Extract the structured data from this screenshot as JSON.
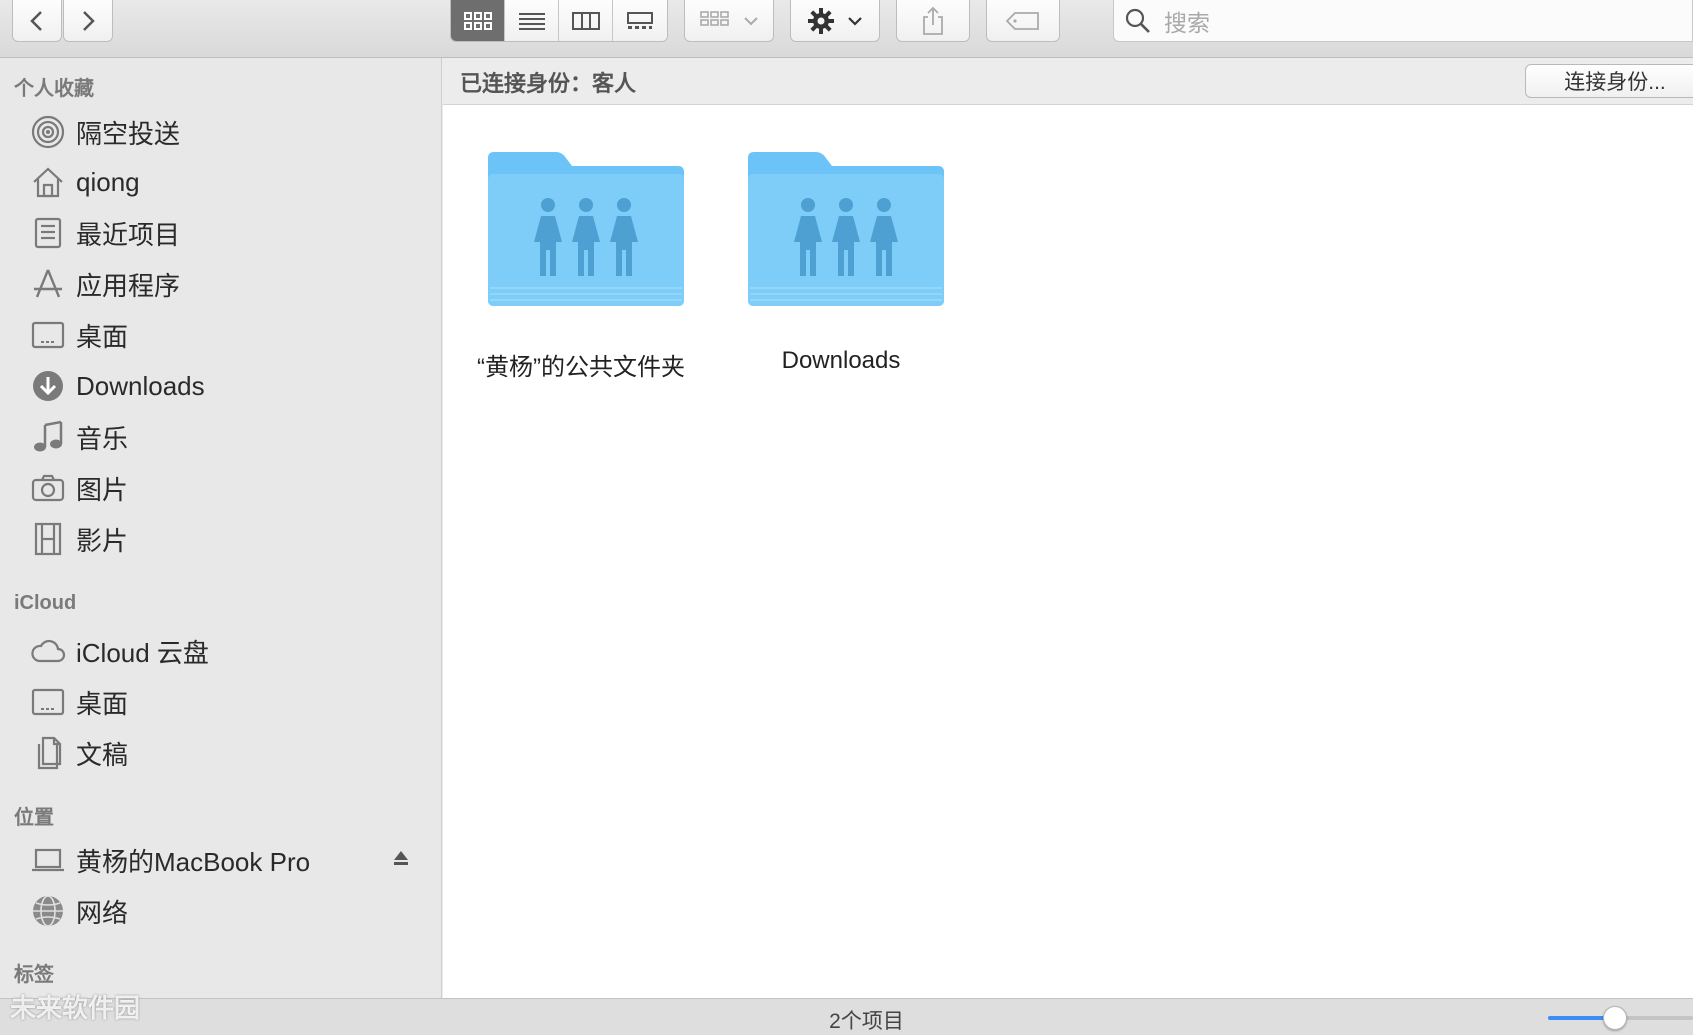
{
  "toolbar": {
    "search_placeholder": "搜索",
    "view_modes": [
      "icon-view",
      "list-view",
      "column-view",
      "gallery-view"
    ],
    "active_view": "icon-view"
  },
  "sidebar": {
    "sections": [
      {
        "title": "个人收藏",
        "items": [
          {
            "label": "隔空投送",
            "icon": "airdrop-icon"
          },
          {
            "label": "qiong",
            "icon": "home-icon"
          },
          {
            "label": "最近项目",
            "icon": "recents-icon"
          },
          {
            "label": "应用程序",
            "icon": "applications-icon"
          },
          {
            "label": "桌面",
            "icon": "desktop-icon"
          },
          {
            "label": "Downloads",
            "icon": "downloads-icon"
          },
          {
            "label": "音乐",
            "icon": "music-icon"
          },
          {
            "label": "图片",
            "icon": "camera-icon"
          },
          {
            "label": "影片",
            "icon": "film-icon"
          }
        ]
      },
      {
        "title": "iCloud",
        "items": [
          {
            "label": "iCloud 云盘",
            "icon": "cloud-icon"
          },
          {
            "label": "桌面",
            "icon": "desktop-icon"
          },
          {
            "label": "文稿",
            "icon": "document-icon"
          }
        ]
      },
      {
        "title": "位置",
        "items": [
          {
            "label": "黄杨的MacBook Pro",
            "icon": "laptop-icon"
          },
          {
            "label": "网络",
            "icon": "network-icon"
          }
        ]
      },
      {
        "title": "标签",
        "items": []
      }
    ]
  },
  "connection": {
    "status": "已连接身份：客人",
    "button_label": "连接身份..."
  },
  "files": [
    {
      "name": "“黄杨”的公共文件夹",
      "icon": "shared-folder-icon"
    },
    {
      "name": "Downloads",
      "icon": "shared-folder-icon"
    }
  ],
  "statusbar": {
    "count": "2个项目",
    "icon_size": 0.45
  },
  "watermark": "未来软件园",
  "colors": {
    "folder": "#6cc3f7",
    "accent": "#3b8cf5"
  }
}
